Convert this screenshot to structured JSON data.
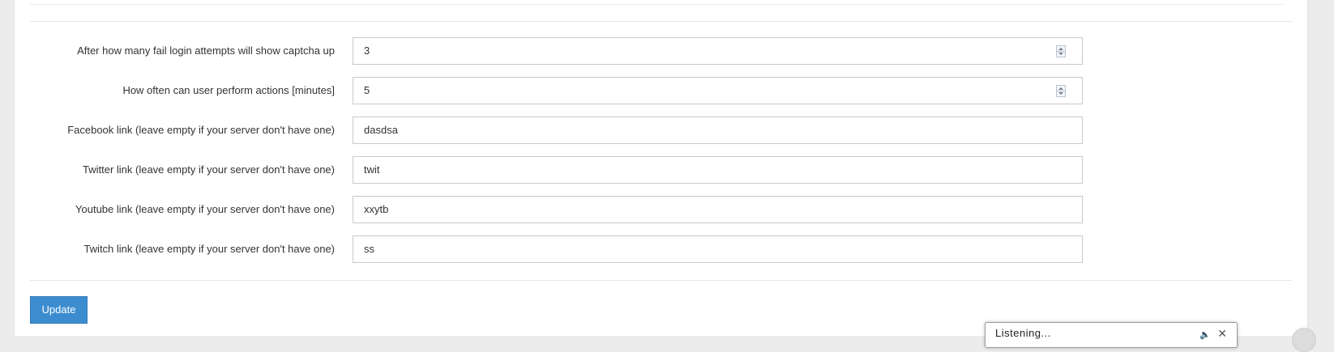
{
  "settings": {
    "rows": [
      {
        "label": "After how many fail login attempts will show captcha up",
        "value": "3",
        "type": "number"
      },
      {
        "label": "How often can user perform actions [minutes]",
        "value": "5",
        "type": "number"
      },
      {
        "label": "Facebook link (leave empty if your server don't have one)",
        "value": "dasdsa",
        "type": "text"
      },
      {
        "label": "Twitter link (leave empty if your server don't have one)",
        "value": "twit",
        "type": "text"
      },
      {
        "label": "Youtube link (leave empty if your server don't have one)",
        "value": "xxytb",
        "type": "text"
      },
      {
        "label": "Twitch link (leave empty if your server don't have one)",
        "value": "ss",
        "type": "text"
      }
    ]
  },
  "actions": {
    "update_label": "Update"
  },
  "popup": {
    "text": "Listening...",
    "sound_icon": "speaker-icon",
    "close_icon": "close-icon"
  },
  "colors": {
    "primary_button": "#3c8dcf",
    "page_background": "#ececec",
    "panel_background": "#ffffff",
    "input_border": "#c9c9c9"
  }
}
